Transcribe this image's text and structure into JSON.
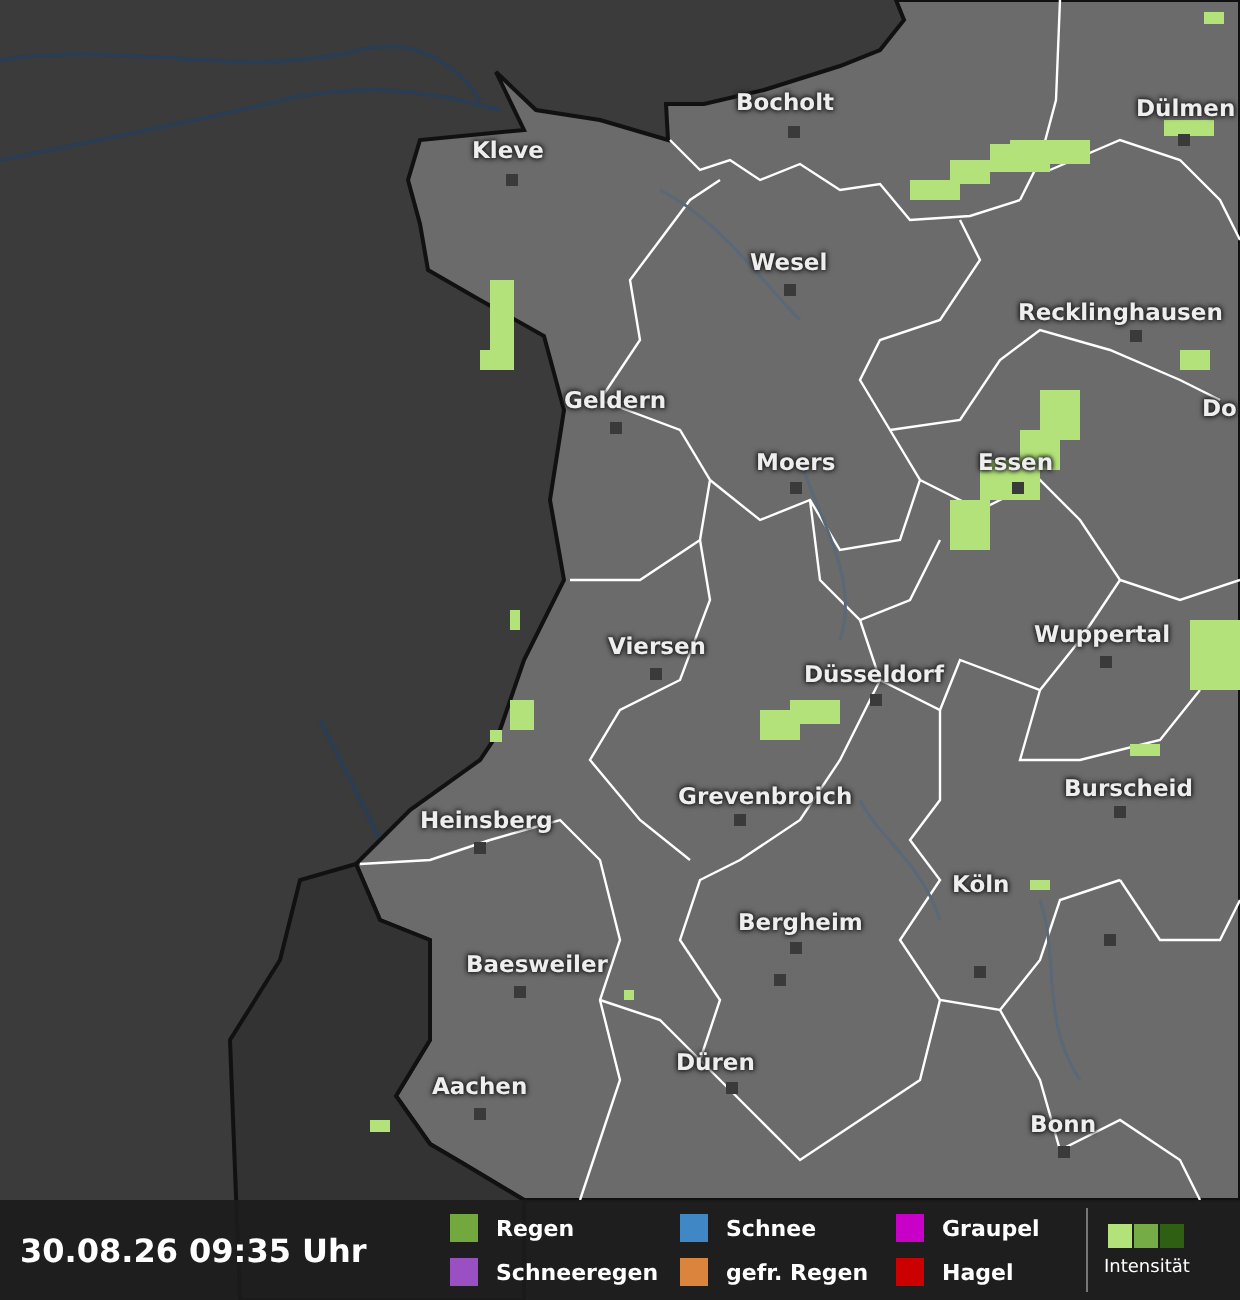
{
  "cities": [
    {
      "name": "Bocholt"
    },
    {
      "name": "Dülmen"
    },
    {
      "name": "Kleve"
    },
    {
      "name": "Wesel"
    },
    {
      "name": "Recklinghausen"
    },
    {
      "name": "Geldern"
    },
    {
      "name": "Do"
    },
    {
      "name": "Moers"
    },
    {
      "name": "Essen"
    },
    {
      "name": "Viersen"
    },
    {
      "name": "Wuppertal"
    },
    {
      "name": "Düsseldorf"
    },
    {
      "name": "Grevenbroich"
    },
    {
      "name": "Burscheid"
    },
    {
      "name": "Heinsberg"
    },
    {
      "name": "Köln"
    },
    {
      "name": "Bergheim"
    },
    {
      "name": "Baesweiler"
    },
    {
      "name": "Düren"
    },
    {
      "name": "Aachen"
    },
    {
      "name": "Bonn"
    }
  ],
  "timestamp": "30.08.26 09:35 Uhr",
  "legend": [
    {
      "label": "Regen",
      "color": "#72a83e"
    },
    {
      "label": "Schneeregen",
      "color": "#9a4fc2"
    },
    {
      "label": "Schnee",
      "color": "#3f88c5"
    },
    {
      "label": "gefr. Regen",
      "color": "#db843d"
    },
    {
      "label": "Graupel",
      "color": "#c800c8"
    },
    {
      "label": "Hagel",
      "color": "#cc0000"
    }
  ],
  "intensity": {
    "label": "Intensität",
    "levels": [
      {
        "color": "#b3e27a"
      },
      {
        "color": "#76ac45"
      },
      {
        "color": "#2f5f12"
      }
    ]
  }
}
